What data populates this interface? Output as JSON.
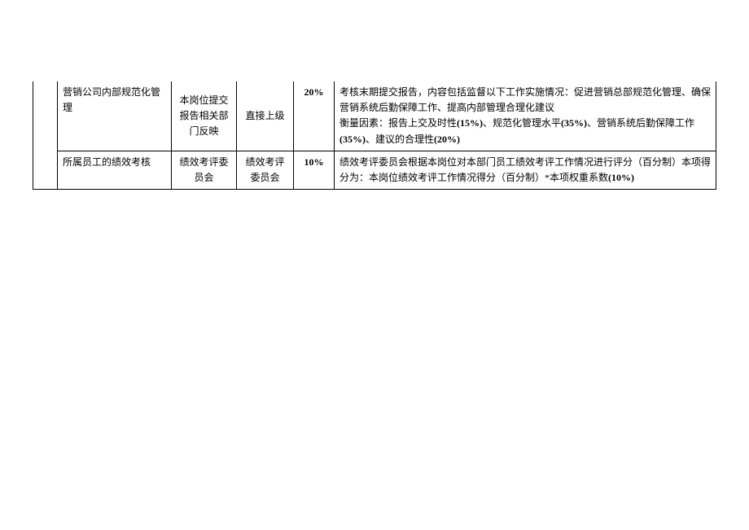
{
  "rows": [
    {
      "task": "营销公司内部规范化管理",
      "submitter": "本岗位提交报告相关部门反映",
      "reviewer": "直接上级",
      "weight": "20%",
      "desc_line1": "考核末期提交报告，内容包括监督以下工作实施情况：促进营销总部规范化管理、确保营销系统后勤保障工作、提高内部管理合理化建议",
      "desc_line2_prefix": "衡量因素：报告上交及时性",
      "m1": "(15%)",
      "sep1": "、规范化管理水平",
      "m2": "(35%)",
      "sep2": "、营销系统后勤保障工作",
      "m3": "(35%)",
      "sep3": "、建议的合理性",
      "m4": "(20%)"
    },
    {
      "task": "所属员工的绩效考核",
      "submitter": "绩效考评委员会",
      "reviewer": "绩效考评委员会",
      "weight": "10%",
      "desc_prefix": "绩效考评委员会根据本岗位对本部门员工绩效考评工作情况进行评分（百分制）本项得分为：本岗位绩效考评工作情况得分（百分制）*本项权重系数",
      "coef": "(10%)"
    }
  ]
}
